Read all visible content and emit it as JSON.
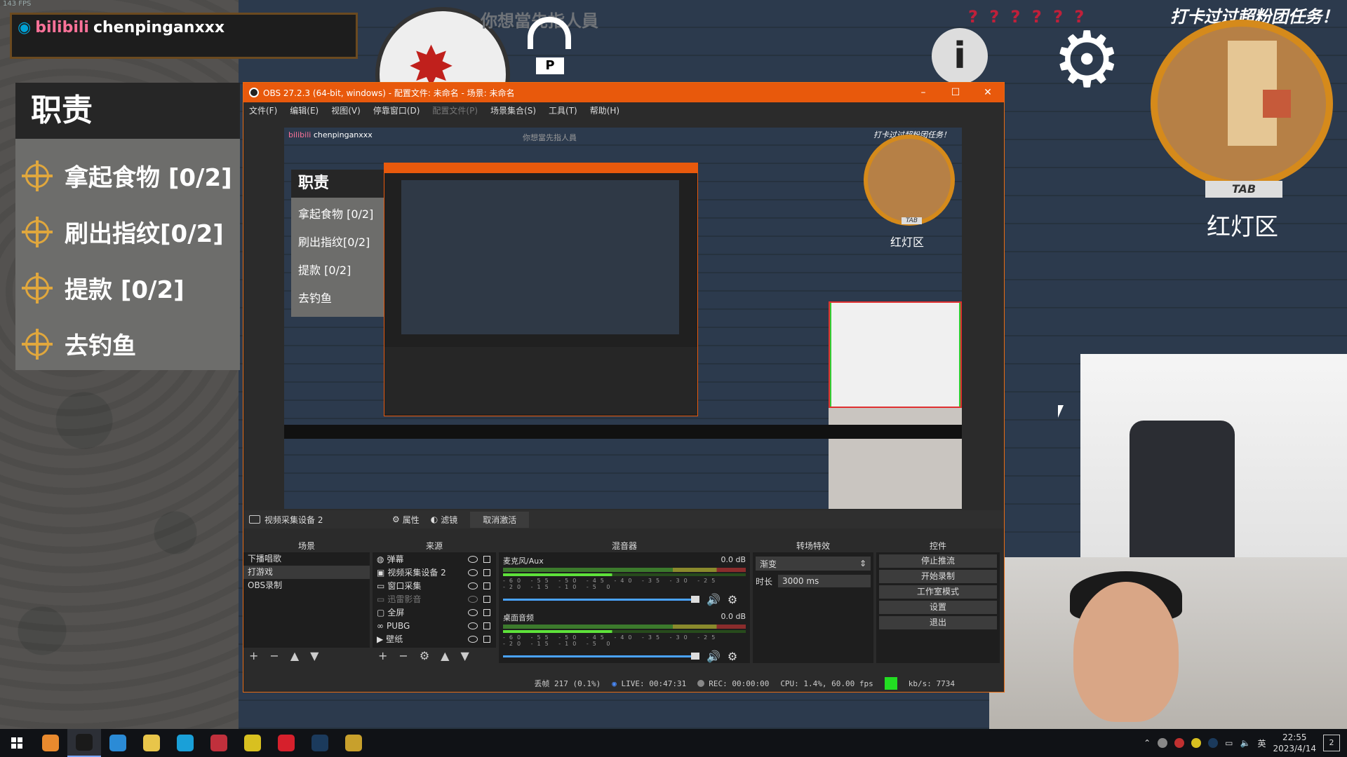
{
  "overlay": {
    "fps_label": "143 FPS",
    "streamer": "chenpinganxxx",
    "bili_logo": "bilibili",
    "game_hint": "你想當先指人員",
    "key_hint": "P",
    "question_marks": "? ? ? ? ? ?",
    "quest_banner": "打卡过过超粉团任务！",
    "minimap_tab": "TAB",
    "zone_name": "红灯区",
    "tasks_title": "职责",
    "tasks": [
      {
        "label": "拿起食物 [0/2]"
      },
      {
        "label": "刷出指纹[0/2]"
      },
      {
        "label": "提款 [0/2]"
      },
      {
        "label": "去钓鱼"
      }
    ]
  },
  "obs": {
    "title": "OBS 27.2.3 (64-bit, windows) - 配置文件: 未命名 - 场景: 未命名",
    "menu": [
      "文件(F)",
      "编辑(E)",
      "视图(V)",
      "停靠窗口(D)",
      "配置文件(P)",
      "场景集合(S)",
      "工具(T)",
      "帮助(H)"
    ],
    "menu_disabled_index": 4,
    "window_controls": {
      "minimize": "–",
      "maximize": "☐",
      "close": "✕"
    },
    "preview": {
      "tasks_title": "职责",
      "tasks": [
        "拿起食物 [0/2]",
        "刷出指纹[0/2]",
        "提款 [0/2]",
        "去钓鱼"
      ],
      "zone": "红灯区",
      "streamer": "chenpinganxxx",
      "bili": "bilibili",
      "hint": "你想當先指人員",
      "quest": "打卡过过超粉团任务！",
      "tab": "TAB"
    },
    "toolbar": {
      "source_name": "视频采集设备 2",
      "properties": "属性",
      "filters": "滤镜",
      "deactivate": "取消激活"
    },
    "docks": {
      "scenes_title": "场景",
      "sources_title": "来源",
      "mixer_title": "混音器",
      "transitions_title": "转场特效",
      "controls_title": "控件"
    },
    "scenes": [
      "下播唱歌",
      "打游戏",
      "OBS录制"
    ],
    "selected_scene": 1,
    "sources": [
      {
        "icon": "globe-icon",
        "label": "弹幕",
        "disabled": false
      },
      {
        "icon": "camera-icon",
        "label": "视频采集设备 2",
        "disabled": false
      },
      {
        "icon": "window-icon",
        "label": "窗口采集",
        "disabled": false
      },
      {
        "icon": "window-icon",
        "label": "迅雷影音",
        "disabled": true
      },
      {
        "icon": "monitor-icon",
        "label": "全屏",
        "disabled": false
      },
      {
        "icon": "link-icon",
        "label": "PUBG",
        "disabled": false
      },
      {
        "icon": "play-icon",
        "label": "壁纸",
        "disabled": false
      }
    ],
    "mixer": [
      {
        "name": "麦克风/Aux",
        "db": "0.0 dB"
      },
      {
        "name": "桌面音频",
        "db": "0.0 dB"
      }
    ],
    "mixer_ticks": "-60 -55 -50 -45 -40 -35 -30 -25 -20 -15 -10 -5 0",
    "transition": {
      "type": "渐变",
      "duration_label": "时长",
      "duration": "3000 ms"
    },
    "controls": [
      "停止推流",
      "开始录制",
      "工作室模式",
      "设置",
      "退出"
    ],
    "status": {
      "dropped": "丢帧 217 (0.1%)",
      "live": "LIVE: 00:47:31",
      "rec": "REC: 00:00:00",
      "cpu": "CPU: 1.4%, 60.00 fps",
      "kbps": "kb/s: 7734"
    }
  },
  "taskbar": {
    "apps": [
      {
        "name": "app-orange",
        "color": "#e98a2e"
      },
      {
        "name": "obs",
        "color": "#1a1a1a"
      },
      {
        "name": "app-blue-ring",
        "color": "#2b8bd6"
      },
      {
        "name": "app-owl",
        "color": "#e8c54a"
      },
      {
        "name": "edge",
        "color": "#1aa0d8"
      },
      {
        "name": "app-red",
        "color": "#c0303c"
      },
      {
        "name": "app-yellow",
        "color": "#d8c020"
      },
      {
        "name": "netease-music",
        "color": "#d6202c"
      },
      {
        "name": "steam",
        "color": "#1b3a5c"
      },
      {
        "name": "app-game",
        "color": "#c8a02c"
      }
    ],
    "ime": "英",
    "time": "22:55",
    "date": "2023/4/14",
    "notifications": "2"
  }
}
